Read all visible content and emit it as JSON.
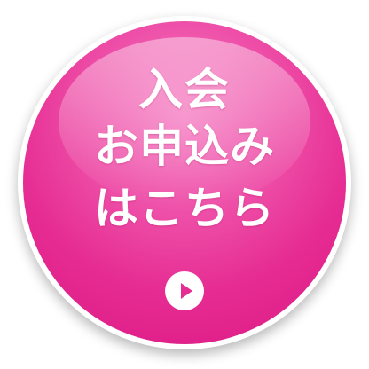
{
  "button": {
    "line1": "入会",
    "line2": "お申込み",
    "line3": "はこちら",
    "icon": "play-circle-icon"
  },
  "colors": {
    "accent": "#e62d93",
    "accent_light": "#f57cc2",
    "text": "#ffffff"
  }
}
